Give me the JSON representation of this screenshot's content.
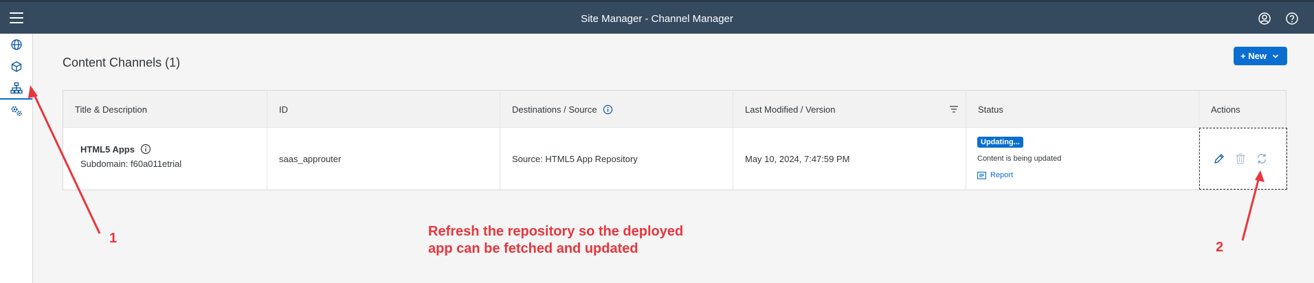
{
  "header": {
    "title": "Site Manager - Channel Manager",
    "menu_icon": "hamburger-menu-icon",
    "user_icon": "user-account-icon",
    "help_icon": "help-icon"
  },
  "sidebar": {
    "items": [
      {
        "icon": "globe-icon",
        "label": "Sites"
      },
      {
        "icon": "cube-icon",
        "label": "Content"
      },
      {
        "icon": "sitemap-icon",
        "label": "Channel Manager",
        "active": true
      },
      {
        "icon": "settings-gears-icon",
        "label": "Settings"
      }
    ]
  },
  "main": {
    "page_title": "Content Channels (1)",
    "new_button": {
      "label": "+ New",
      "chevron_icon": "chevron-down-icon"
    }
  },
  "table": {
    "columns": [
      "Title & Description",
      "ID",
      "Destinations / Source",
      "Last Modified / Version",
      "Status",
      "Actions"
    ],
    "rows": [
      {
        "title": "HTML5 Apps",
        "subdomain": "Subdomain: f60a011etrial",
        "id": "saas_approuter",
        "source": "Source: HTML5 App Repository",
        "last_modified": "May 10, 2024, 7:47:59 PM",
        "status_badge": "Updating...",
        "status_text": "Content is being updated",
        "report_label": "Report"
      }
    ]
  },
  "annotations": {
    "label_1": "1",
    "label_2": "2",
    "note_line1": "Refresh the repository so the deployed",
    "note_line2": "app can be fetched and updated"
  },
  "colors": {
    "header_bg": "#354a5f",
    "accent": "#0a6ed1",
    "annotation": "#e8363d"
  }
}
